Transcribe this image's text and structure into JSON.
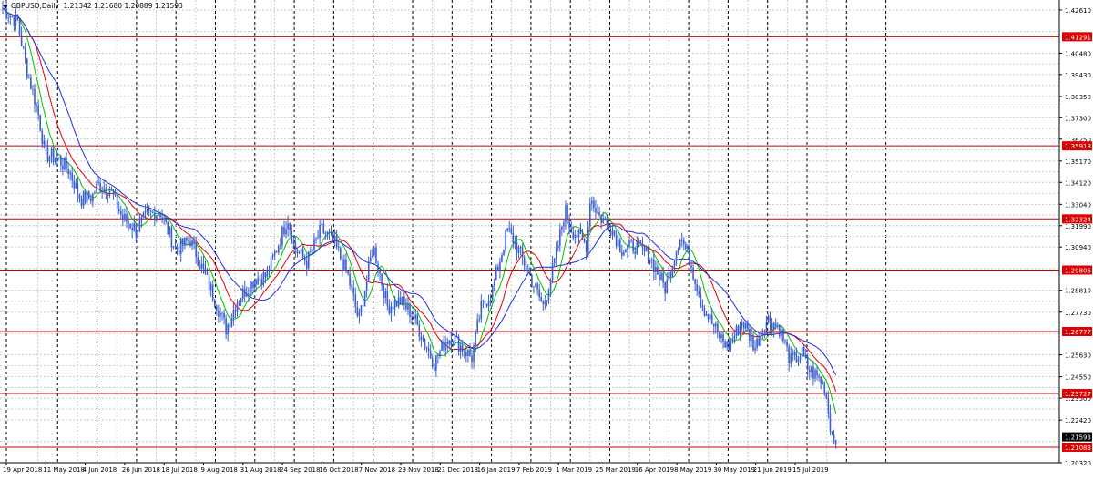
{
  "header": {
    "symbol": "GBPUSD,Daily",
    "ohlc": "1.21342 1.21680 1.20889 1.21593"
  },
  "colors": {
    "background": "#ffffff",
    "candles": "#3a5fcd",
    "grid": "#c8c8c8",
    "period_separator": "#000000",
    "level_lines": "#cc0000",
    "ma_fast": "#00c000",
    "ma_mid": "#e00000",
    "ma_slow": "#1c2ee0",
    "level_label_bg": "#e00000",
    "current_price_bg": "#000000"
  },
  "chart_data": {
    "type": "line",
    "chart_style": "candlestick-style bars (daily) with three moving averages",
    "ylim": [
      1.2032,
      1.431
    ],
    "grid": true,
    "x_ticks": [
      "19 Apr 2018",
      "11 May 2018",
      "4 Jun 2018",
      "26 Jun 2018",
      "18 Jul 2018",
      "9 Aug 2018",
      "31 Aug 2018",
      "24 Sep 2018",
      "16 Oct 2018",
      "7 Nov 2018",
      "29 Nov 2018",
      "21 Dec 2018",
      "16 Jan 2019",
      "7 Feb 2019",
      "1 Mar 2019",
      "25 Mar 2019",
      "16 Apr 2019",
      "8 May 2019",
      "30 May 2019",
      "21 Jun 2019",
      "15 Jul 2019"
    ],
    "y_ticks": [
      "1.42610",
      "1.40480",
      "1.39430",
      "1.38350",
      "1.37300",
      "1.36250",
      "1.35170",
      "1.34120",
      "1.33040",
      "1.31990",
      "1.30940",
      "1.28810",
      "1.27730",
      "1.25630",
      "1.24550",
      "1.23500",
      "1.22420",
      "1.20320"
    ],
    "y_tick_values": [
      1.4261,
      1.4048,
      1.3943,
      1.3835,
      1.373,
      1.3625,
      1.3517,
      1.3412,
      1.3304,
      1.3199,
      1.3094,
      1.2881,
      1.2773,
      1.2563,
      1.2455,
      1.235,
      1.2242,
      1.2032
    ],
    "horizontal_levels": [
      {
        "label": "1.41291",
        "value": 1.41291
      },
      {
        "label": "1.35918",
        "value": 1.35918
      },
      {
        "label": "1.32324",
        "value": 1.32324
      },
      {
        "label": "1.29805",
        "value": 1.29805
      },
      {
        "label": "1.26777",
        "value": 1.26777
      },
      {
        "label": "1.23727",
        "value": 1.23727
      },
      {
        "label": "1.21083",
        "value": 1.21083
      }
    ],
    "current_price": {
      "label": "1.21593",
      "value": 1.21593
    },
    "price_path": [
      {
        "date": "19 Apr 2018",
        "value": 1.418
      },
      {
        "date": "24 Apr 2018",
        "value": 1.396
      },
      {
        "date": "30 Apr 2018",
        "value": 1.376
      },
      {
        "date": "4 May 2018",
        "value": 1.355
      },
      {
        "date": "11 May 2018",
        "value": 1.353
      },
      {
        "date": "18 May 2018",
        "value": 1.347
      },
      {
        "date": "25 May 2018",
        "value": 1.333
      },
      {
        "date": "1 Jun 2018",
        "value": 1.334
      },
      {
        "date": "4 Jun 2018",
        "value": 1.34
      },
      {
        "date": "11 Jun 2018",
        "value": 1.338
      },
      {
        "date": "18 Jun 2018",
        "value": 1.324
      },
      {
        "date": "26 Jun 2018",
        "value": 1.318
      },
      {
        "date": "2 Jul 2018",
        "value": 1.325
      },
      {
        "date": "9 Jul 2018",
        "value": 1.327
      },
      {
        "date": "18 Jul 2018",
        "value": 1.308
      },
      {
        "date": "26 Jul 2018",
        "value": 1.313
      },
      {
        "date": "2 Aug 2018",
        "value": 1.298
      },
      {
        "date": "9 Aug 2018",
        "value": 1.283
      },
      {
        "date": "15 Aug 2018",
        "value": 1.269
      },
      {
        "date": "21 Aug 2018",
        "value": 1.283
      },
      {
        "date": "31 Aug 2018",
        "value": 1.294
      },
      {
        "date": "7 Sep 2018",
        "value": 1.295
      },
      {
        "date": "14 Sep 2018",
        "value": 1.31
      },
      {
        "date": "20 Sep 2018",
        "value": 1.324
      },
      {
        "date": "24 Sep 2018",
        "value": 1.309
      },
      {
        "date": "1 Oct 2018",
        "value": 1.302
      },
      {
        "date": "9 Oct 2018",
        "value": 1.318
      },
      {
        "date": "16 Oct 2018",
        "value": 1.312
      },
      {
        "date": "24 Oct 2018",
        "value": 1.295
      },
      {
        "date": "30 Oct 2018",
        "value": 1.273
      },
      {
        "date": "7 Nov 2018",
        "value": 1.31
      },
      {
        "date": "15 Nov 2018",
        "value": 1.28
      },
      {
        "date": "22 Nov 2018",
        "value": 1.283
      },
      {
        "date": "29 Nov 2018",
        "value": 1.276
      },
      {
        "date": "11 Dec 2018",
        "value": 1.252
      },
      {
        "date": "17 Dec 2018",
        "value": 1.263
      },
      {
        "date": "21 Dec 2018",
        "value": 1.265
      },
      {
        "date": "3 Jan 2019",
        "value": 1.255
      },
      {
        "date": "9 Jan 2019",
        "value": 1.279
      },
      {
        "date": "16 Jan 2019",
        "value": 1.287
      },
      {
        "date": "25 Jan 2019",
        "value": 1.318
      },
      {
        "date": "31 Jan 2019",
        "value": 1.308
      },
      {
        "date": "7 Feb 2019",
        "value": 1.294
      },
      {
        "date": "14 Feb 2019",
        "value": 1.28
      },
      {
        "date": "21 Feb 2019",
        "value": 1.305
      },
      {
        "date": "26 Feb 2019",
        "value": 1.328
      },
      {
        "date": "1 Mar 2019",
        "value": 1.319
      },
      {
        "date": "11 Mar 2019",
        "value": 1.31
      },
      {
        "date": "13 Mar 2019",
        "value": 1.334
      },
      {
        "date": "19 Mar 2019",
        "value": 1.324
      },
      {
        "date": "25 Mar 2019",
        "value": 1.32
      },
      {
        "date": "1 Apr 2019",
        "value": 1.308
      },
      {
        "date": "8 Apr 2019",
        "value": 1.31
      },
      {
        "date": "16 Apr 2019",
        "value": 1.305
      },
      {
        "date": "25 Apr 2019",
        "value": 1.289
      },
      {
        "date": "3 May 2019",
        "value": 1.315
      },
      {
        "date": "8 May 2019",
        "value": 1.305
      },
      {
        "date": "16 May 2019",
        "value": 1.28
      },
      {
        "date": "24 May 2019",
        "value": 1.267
      },
      {
        "date": "30 May 2019",
        "value": 1.26
      },
      {
        "date": "7 Jun 2019",
        "value": 1.273
      },
      {
        "date": "14 Jun 2019",
        "value": 1.26
      },
      {
        "date": "21 Jun 2019",
        "value": 1.274
      },
      {
        "date": "28 Jun 2019",
        "value": 1.27
      },
      {
        "date": "5 Jul 2019",
        "value": 1.253
      },
      {
        "date": "12 Jul 2019",
        "value": 1.257
      },
      {
        "date": "15 Jul 2019",
        "value": 1.25
      },
      {
        "date": "22 Jul 2019",
        "value": 1.245
      },
      {
        "date": "26 Jul 2019",
        "value": 1.24
      },
      {
        "date": "30 Jul 2019",
        "value": 1.217
      },
      {
        "date": "2 Aug 2019",
        "value": 1.2159
      }
    ],
    "series": [
      {
        "name": "",
        "values": []
      }
    ]
  }
}
